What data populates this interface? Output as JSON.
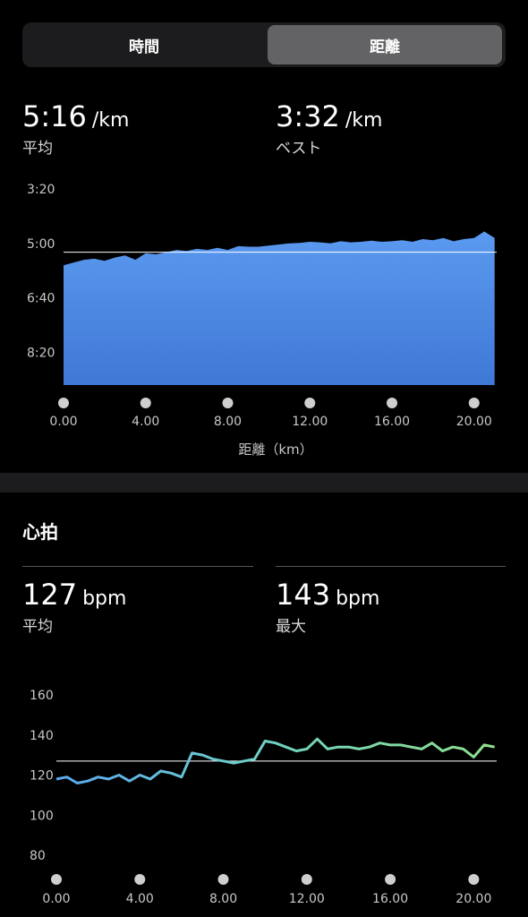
{
  "segmented": {
    "tabs": [
      {
        "label": "時間"
      },
      {
        "label": "距離"
      }
    ],
    "selected": "距離"
  },
  "pace": {
    "avg": {
      "value": "5:16",
      "unit": "/km",
      "label": "平均"
    },
    "best": {
      "value": "3:32",
      "unit": "/km",
      "label": "ベスト"
    }
  },
  "heart_rate": {
    "title": "心拍",
    "avg": {
      "value": "127",
      "unit": "bpm",
      "label": "平均"
    },
    "max": {
      "value": "143",
      "unit": "bpm",
      "label": "最大"
    }
  },
  "chart_data": [
    {
      "type": "area",
      "title": "",
      "xlabel": "距離（km）",
      "ylabel": "",
      "y_axis_inverted": true,
      "y_ticks": [
        "3:20",
        "5:00",
        "6:40",
        "8:20"
      ],
      "x_ticks": [
        "0.00",
        "4.00",
        "8.00",
        "12.00",
        "16.00",
        "20.00"
      ],
      "xlim": [
        0,
        21.1
      ],
      "ylim_seconds_per_km": [
        200,
        560
      ],
      "reference_line": "5:16",
      "color": "#4a86e0",
      "series": [
        {
          "x": [
            0.0,
            0.5,
            1.0,
            1.5,
            2.0,
            2.5,
            3.0,
            3.5,
            4.0,
            4.5,
            5.0,
            5.5,
            6.0,
            6.5,
            7.0,
            7.5,
            8.0,
            8.5,
            9.0,
            9.5,
            10.0,
            10.5,
            11.0,
            11.5,
            12.0,
            12.5,
            13.0,
            13.5,
            14.0,
            14.5,
            15.0,
            15.5,
            16.0,
            16.5,
            17.0,
            17.5,
            18.0,
            18.5,
            19.0,
            19.5,
            20.0,
            20.5,
            21.0
          ],
          "y": [
            340,
            335,
            330,
            328,
            332,
            326,
            322,
            330,
            318,
            320,
            316,
            312,
            314,
            310,
            312,
            308,
            312,
            305,
            306,
            306,
            304,
            302,
            300,
            299,
            297,
            298,
            300,
            296,
            298,
            297,
            295,
            297,
            296,
            294,
            297,
            292,
            294,
            290,
            296,
            292,
            290,
            278,
            290
          ]
        }
      ]
    },
    {
      "type": "line",
      "title": "",
      "xlabel": "",
      "ylabel": "",
      "y_ticks": [
        "160",
        "140",
        "120",
        "100",
        "80"
      ],
      "x_ticks": [
        "0.00",
        "4.00",
        "8.00",
        "12.00",
        "16.00",
        "20.00"
      ],
      "xlim": [
        0,
        21.1
      ],
      "ylim": [
        80,
        160
      ],
      "reference_line": 127,
      "series": [
        {
          "x": [
            0.0,
            0.5,
            1.0,
            1.5,
            2.0,
            2.5,
            3.0,
            3.5,
            4.0,
            4.5,
            5.0,
            5.5,
            6.0,
            6.5,
            7.0,
            7.5,
            8.0,
            8.5,
            9.0,
            9.5,
            10.0,
            10.5,
            11.0,
            11.5,
            12.0,
            12.5,
            13.0,
            13.5,
            14.0,
            14.5,
            15.0,
            15.5,
            16.0,
            16.5,
            17.0,
            17.5,
            18.0,
            18.5,
            19.0,
            19.5,
            20.0,
            20.5,
            21.0
          ],
          "y": [
            118,
            119,
            116,
            117,
            119,
            118,
            120,
            117,
            120,
            118,
            122,
            121,
            119,
            131,
            130,
            128,
            127,
            126,
            127,
            128,
            137,
            136,
            134,
            132,
            133,
            138,
            133,
            134,
            134,
            133,
            134,
            136,
            135,
            135,
            134,
            133,
            136,
            132,
            134,
            133,
            129,
            135,
            134
          ]
        }
      ]
    }
  ]
}
